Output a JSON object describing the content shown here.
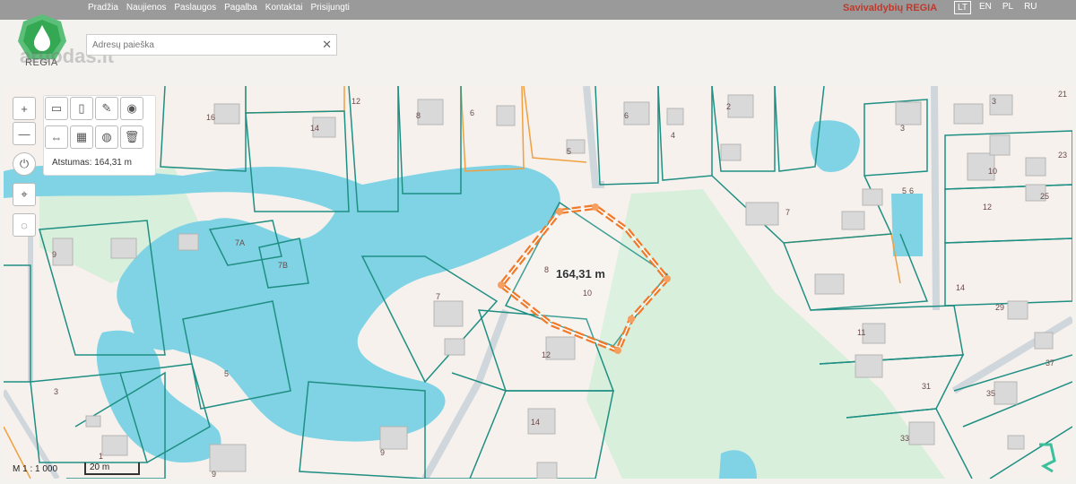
{
  "nav": [
    "Pradžia",
    "Naujienos",
    "Paslaugos",
    "Pagalba",
    "Kontaktai",
    "Prisijungti"
  ],
  "brand": "Savivaldybių REGIA",
  "languages": [
    "LT",
    "EN",
    "PL",
    "RU"
  ],
  "active_language": "LT",
  "logo_text": "REGIA",
  "watermark": "aruodas.lt",
  "search": {
    "placeholder": "Adresų paieška"
  },
  "tools": {
    "zoom_in": "+",
    "zoom_out": "—",
    "distance_label": "Atstumas: 164,31 m"
  },
  "measure_label": "164,31 m",
  "scale": {
    "ratio": "M 1 : 1 000",
    "bar": "20 m"
  },
  "parcel_labels": [
    "16",
    "12",
    "8",
    "6",
    "5",
    "6",
    "4",
    "2",
    "3",
    "14",
    "7A",
    "7B",
    "9",
    "7",
    "8",
    "10",
    "7",
    "5",
    "21",
    "3",
    "23",
    "10",
    "25",
    "12",
    "14",
    "29",
    "11",
    "37",
    "31",
    "35",
    "33",
    "12",
    "3",
    "5",
    "1",
    "9",
    "14",
    "9",
    "6"
  ]
}
